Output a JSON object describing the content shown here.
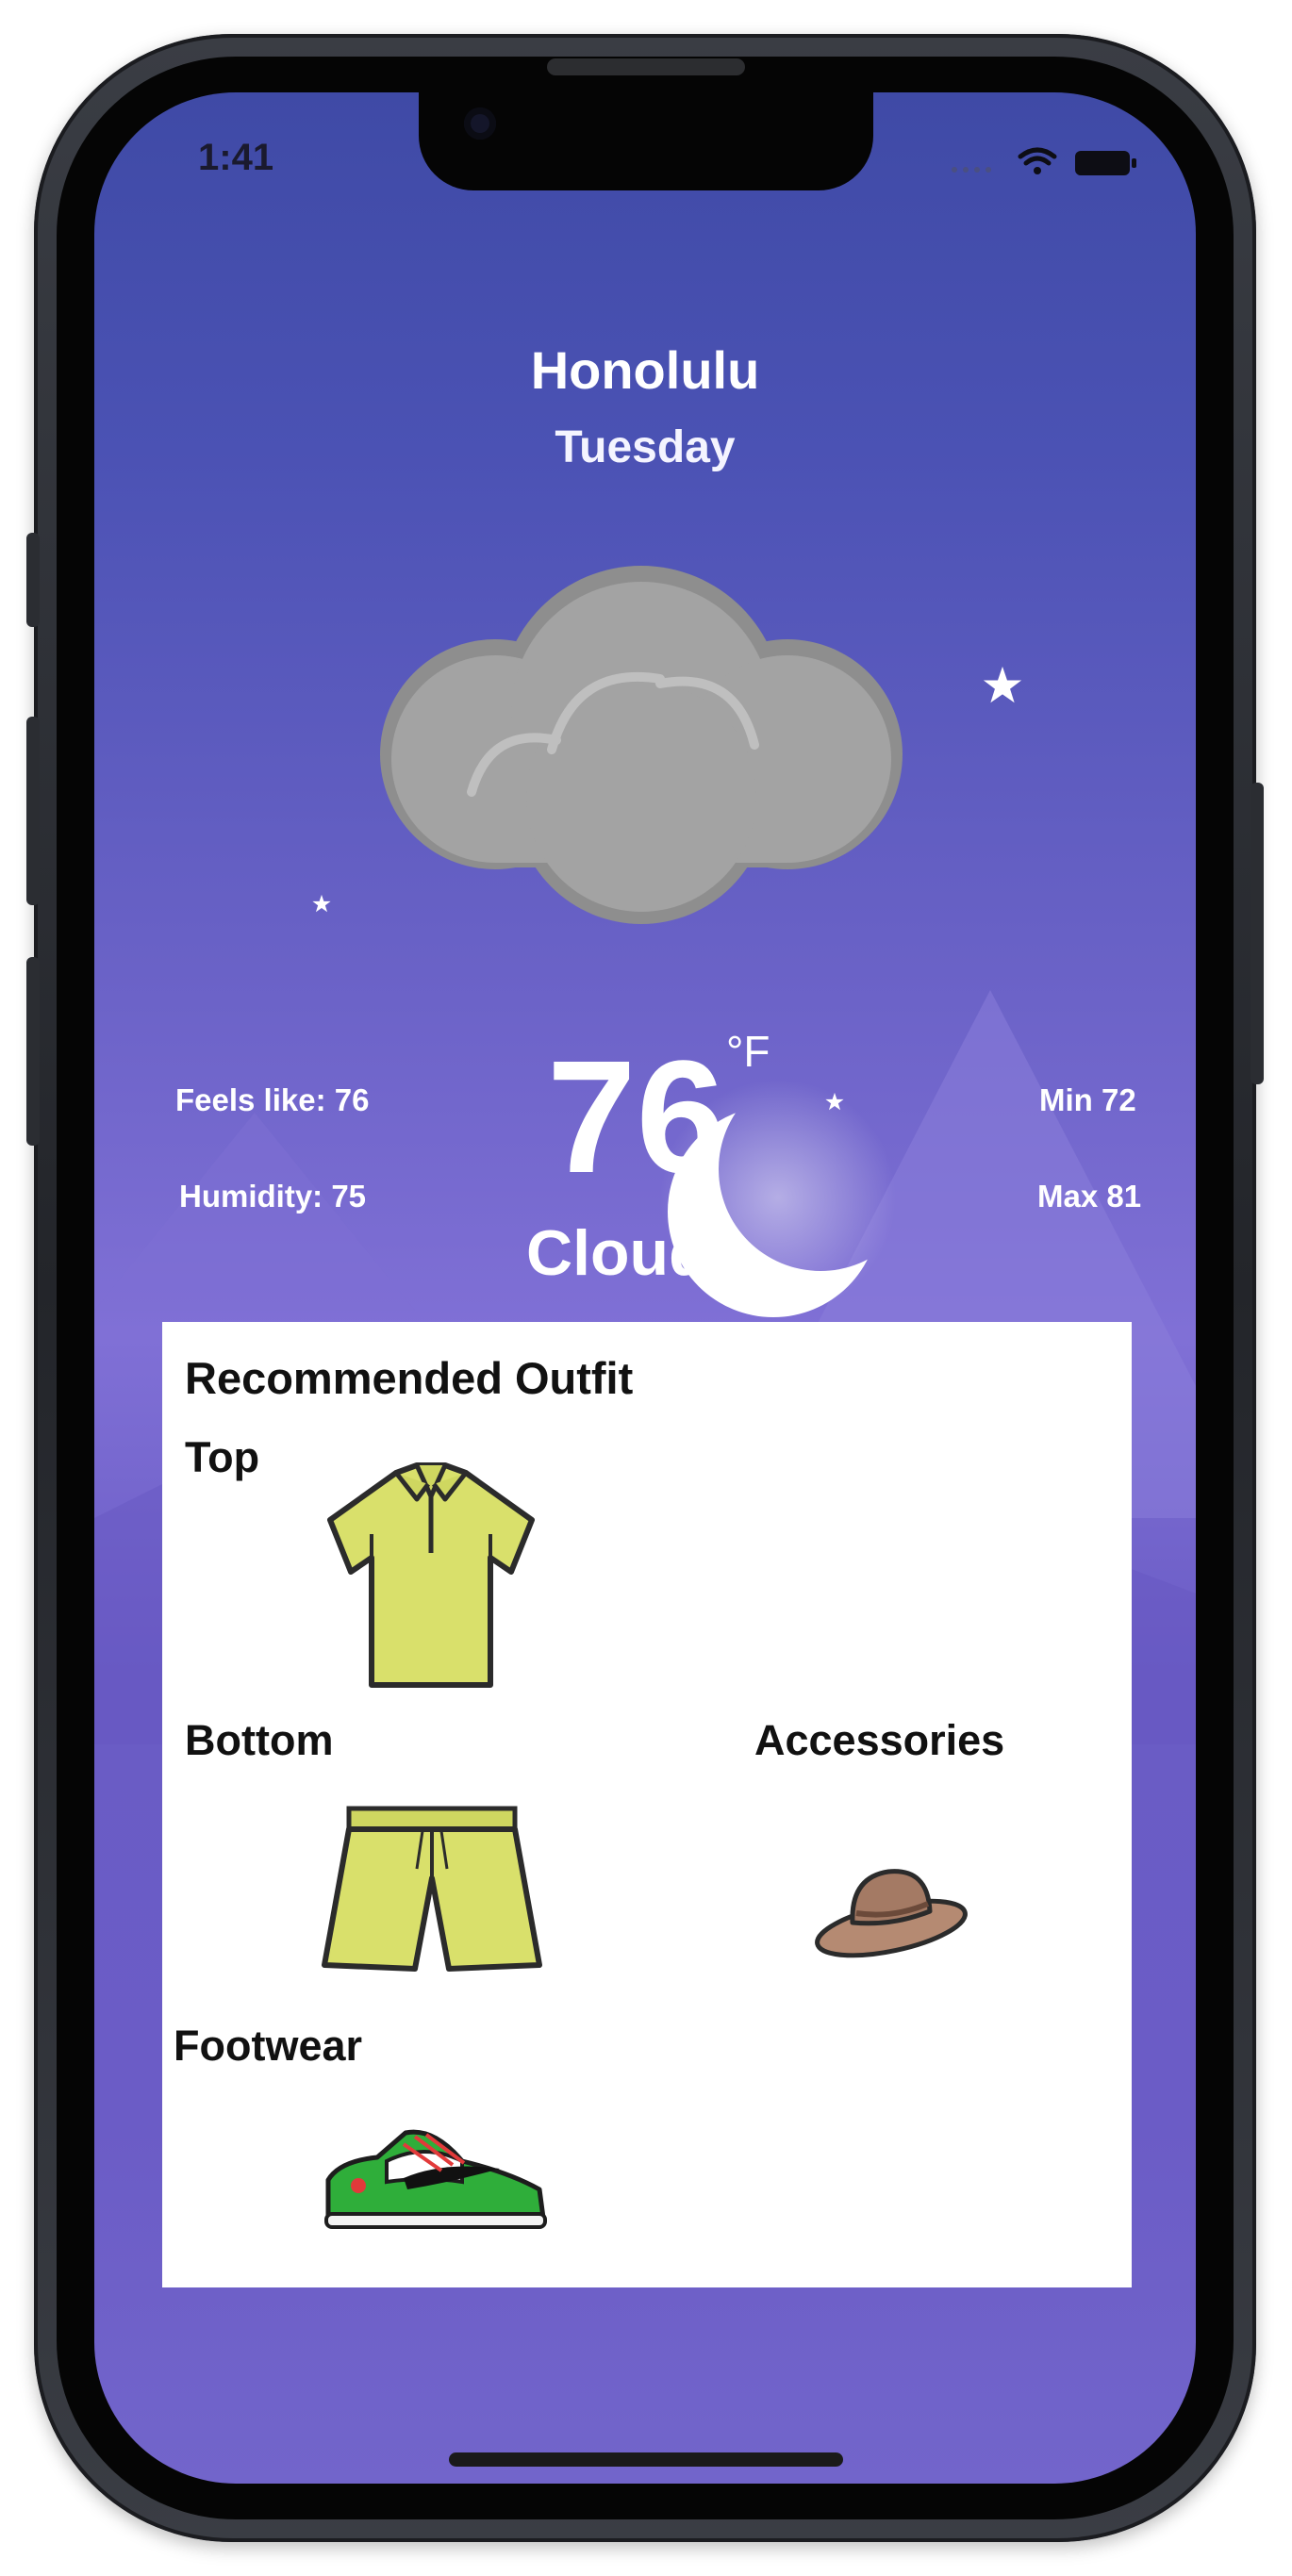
{
  "status_bar": {
    "time": "1:41"
  },
  "location": {
    "city": "Honolulu",
    "day": "Tuesday"
  },
  "weather": {
    "temperature": "76",
    "unit": "°F",
    "condition": "Cloud",
    "feels_like": "Feels like: 76",
    "humidity": "Humidity: 75",
    "min": "Min 72",
    "max": "Max 81"
  },
  "outfit": {
    "title": "Recommended Outfit",
    "top_label": "Top",
    "bottom_label": "Bottom",
    "accessories_label": "Accessories",
    "footwear_label": "Footwear"
  },
  "icons": [
    "cloud-icon",
    "moon-icon",
    "star-icon",
    "wifi-icon",
    "battery-icon",
    "signal-icon",
    "polo-shirt-icon",
    "shorts-icon",
    "hat-icon",
    "sneaker-icon"
  ],
  "colors": {
    "background_top": "#3f4aa6",
    "background_bottom": "#7265cb",
    "card": "#ffffff",
    "clothing": "#d9e06b"
  }
}
